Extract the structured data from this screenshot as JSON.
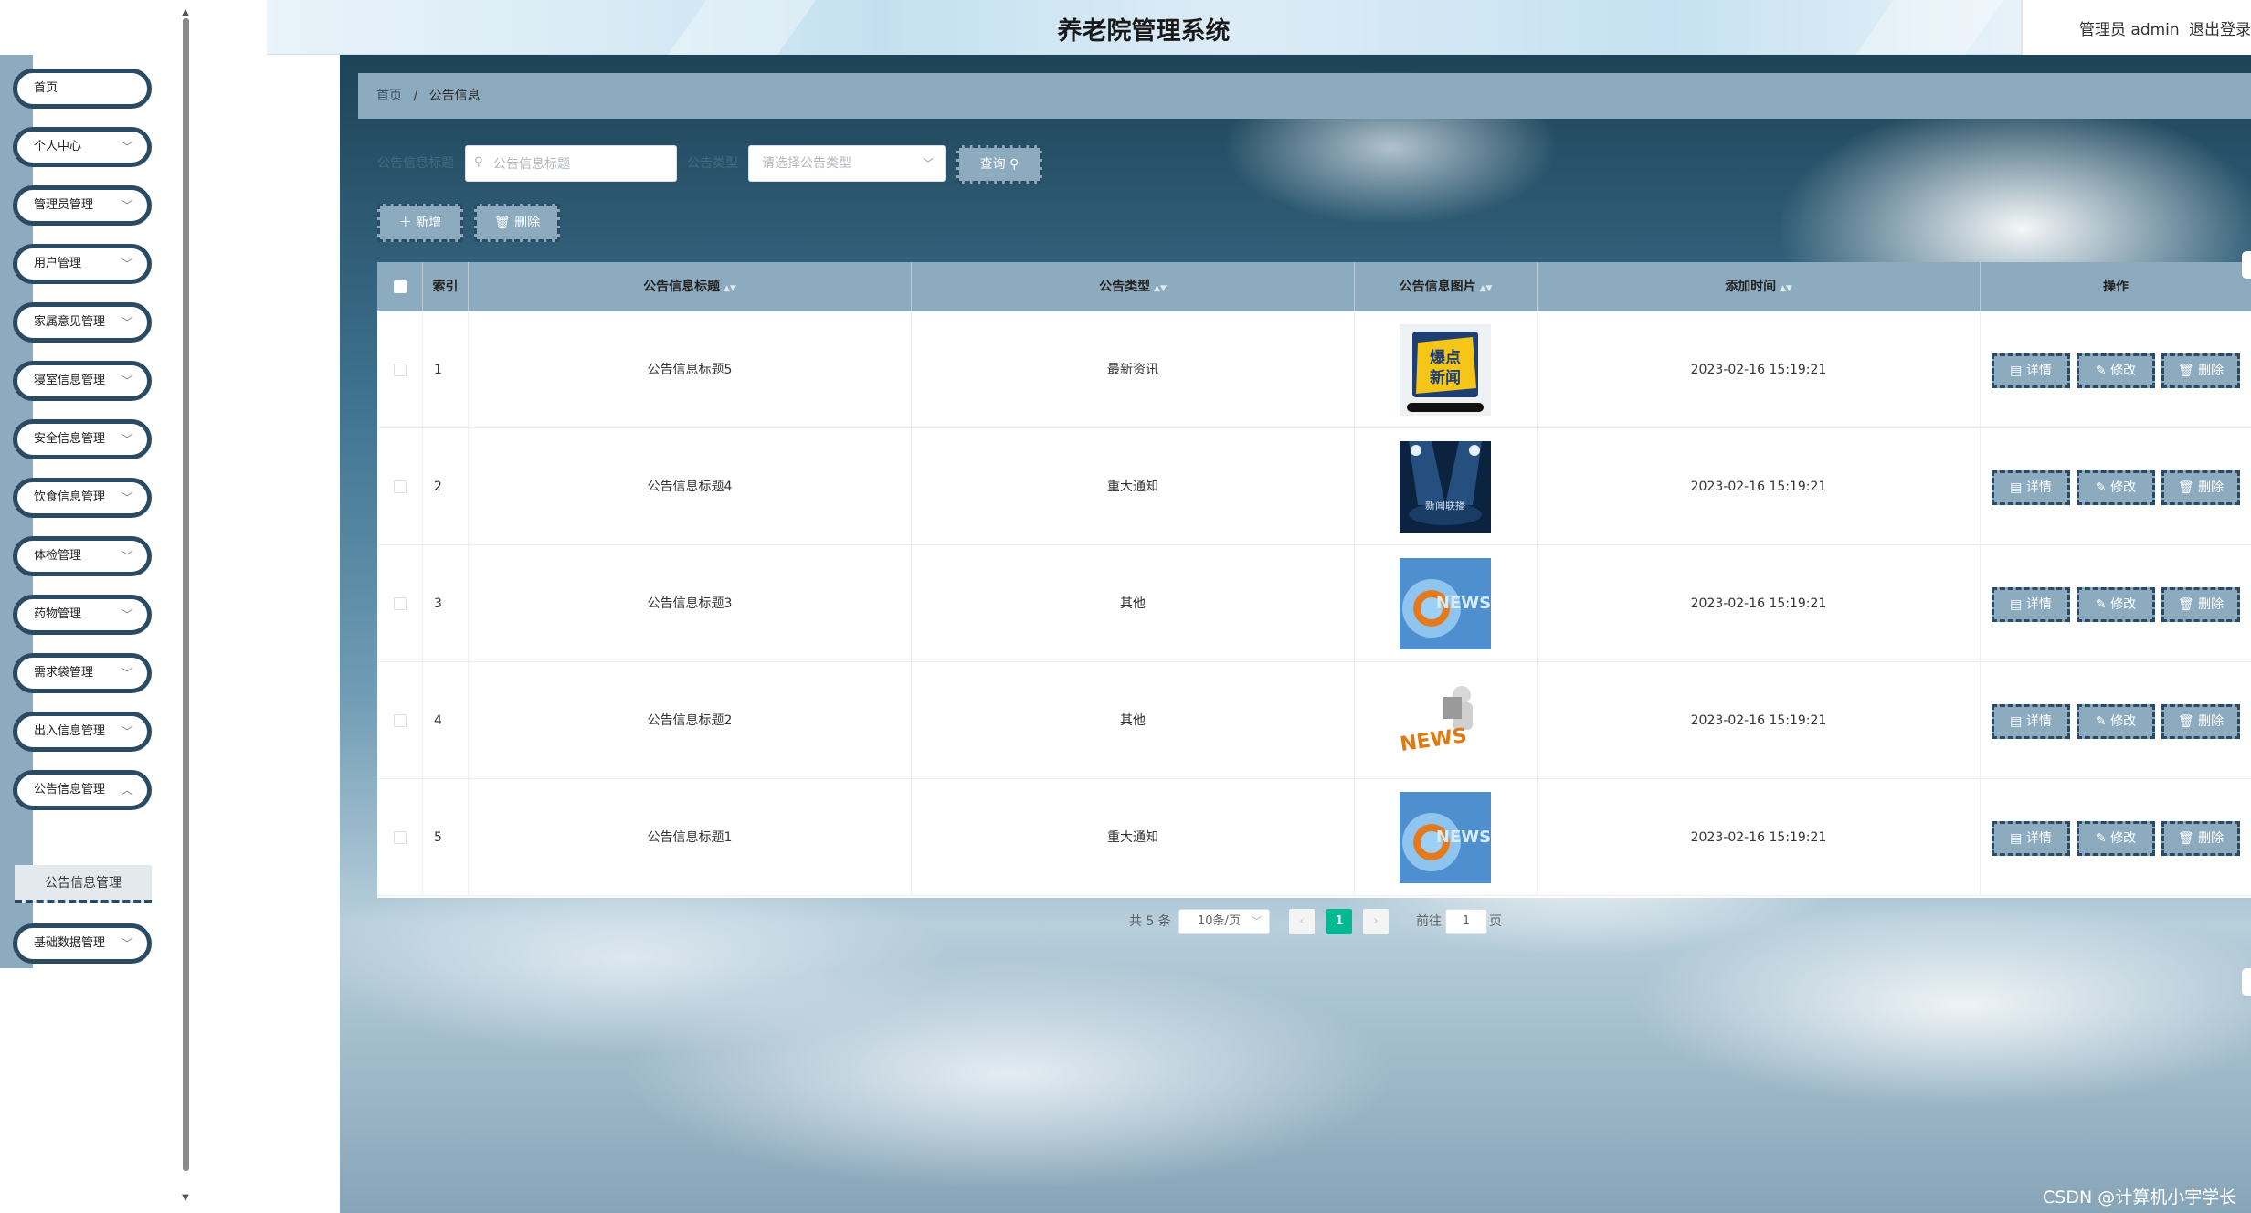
{
  "header": {
    "title": "养老院管理系统",
    "user_label": "管理员 admin",
    "logout_label": "退出登录"
  },
  "sidebar": {
    "items": [
      {
        "label": "首页",
        "has_submenu": false
      },
      {
        "label": "个人中心",
        "has_submenu": true
      },
      {
        "label": "管理员管理",
        "has_submenu": true
      },
      {
        "label": "用户管理",
        "has_submenu": true
      },
      {
        "label": "家属意见管理",
        "has_submenu": true
      },
      {
        "label": "寝室信息管理",
        "has_submenu": true
      },
      {
        "label": "安全信息管理",
        "has_submenu": true
      },
      {
        "label": "饮食信息管理",
        "has_submenu": true
      },
      {
        "label": "体检管理",
        "has_submenu": true
      },
      {
        "label": "药物管理",
        "has_submenu": true
      },
      {
        "label": "需求袋管理",
        "has_submenu": true
      },
      {
        "label": "出入信息管理",
        "has_submenu": true
      },
      {
        "label": "公告信息管理",
        "has_submenu": true
      },
      {
        "label": "基础数据管理",
        "has_submenu": true
      }
    ],
    "active_subitem": "公告信息管理"
  },
  "breadcrumb": {
    "home": "首页",
    "separator": "/",
    "current": "公告信息"
  },
  "search": {
    "title_label": "公告信息标题",
    "title_placeholder": "公告信息标题",
    "type_label": "公告类型",
    "type_placeholder": "请选择公告类型",
    "query_button": "查询"
  },
  "actions": {
    "add_button": "新增",
    "delete_button": "删除"
  },
  "table": {
    "columns": [
      "索引",
      "公告信息标题",
      "公告类型",
      "公告信息图片",
      "添加时间",
      "操作"
    ],
    "rows": [
      {
        "index": "1",
        "title": "公告信息标题5",
        "type": "最新资讯",
        "image": "爆点新闻",
        "time": "2023-02-16 15:19:21"
      },
      {
        "index": "2",
        "title": "公告信息标题4",
        "type": "重大通知",
        "image": "新闻联播",
        "time": "2023-02-16 15:19:21"
      },
      {
        "index": "3",
        "title": "公告信息标题3",
        "type": "其他",
        "image": "NEWS",
        "time": "2023-02-16 15:19:21"
      },
      {
        "index": "4",
        "title": "公告信息标题2",
        "type": "其他",
        "image": "NEWS",
        "time": "2023-02-16 15:19:21"
      },
      {
        "index": "5",
        "title": "公告信息标题1",
        "type": "重大通知",
        "image": "NEWS",
        "time": "2023-02-16 15:19:21"
      }
    ],
    "row_buttons": {
      "detail": "详情",
      "edit": "修改",
      "delete": "删除"
    }
  },
  "pagination": {
    "total": "共 5 条",
    "page_size": "10条/页",
    "current_page": "1",
    "goto_label": "前往",
    "goto_value": "1",
    "page_suffix": "页"
  },
  "watermark": "CSDN @计算机小宇学长",
  "colors": {
    "accent": "#8cabbf",
    "dark_border": "#2b4a63",
    "pager_active": "#00b894"
  }
}
